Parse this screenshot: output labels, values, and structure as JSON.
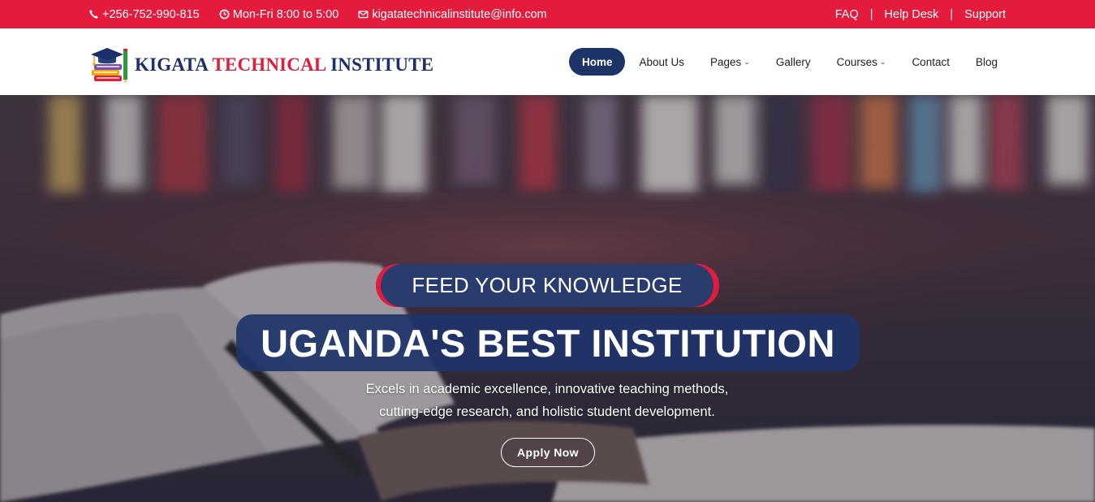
{
  "topbar": {
    "phone": "+256-752-990-815",
    "hours": "Mon-Fri 8:00 to 5:00",
    "email": "kigatatechnicalinstitute@info.com",
    "links": [
      "FAQ",
      "Help Desk",
      "Support"
    ],
    "separator": "|",
    "background_color": "#e41b3c"
  },
  "brand": {
    "name_part1": "KIGATA",
    "name_part2": "TECHNICAL",
    "name_part3": "INSTITUTE",
    "primary_color": "#1c2f6b",
    "accent_color": "#e41b3c",
    "logo_icon": "books-graduation-cap-icon"
  },
  "nav": {
    "items": [
      {
        "label": "Home",
        "active": true
      },
      {
        "label": "About Us"
      },
      {
        "label": "Pages",
        "dropdown": true
      },
      {
        "label": "Gallery"
      },
      {
        "label": "Courses",
        "dropdown": true
      },
      {
        "label": "Contact"
      },
      {
        "label": "Blog"
      }
    ],
    "chevron": "⌄"
  },
  "hero": {
    "eyebrow": "FEED YOUR KNOWLEDGE",
    "title": "UGANDA'S BEST INSTITUTION",
    "description_line1": "Excels in academic excellence, innovative teaching methods,",
    "description_line2": "cutting-edge research, and holistic student development.",
    "cta": "Apply Now",
    "background_image": "open-book-library-photo"
  }
}
